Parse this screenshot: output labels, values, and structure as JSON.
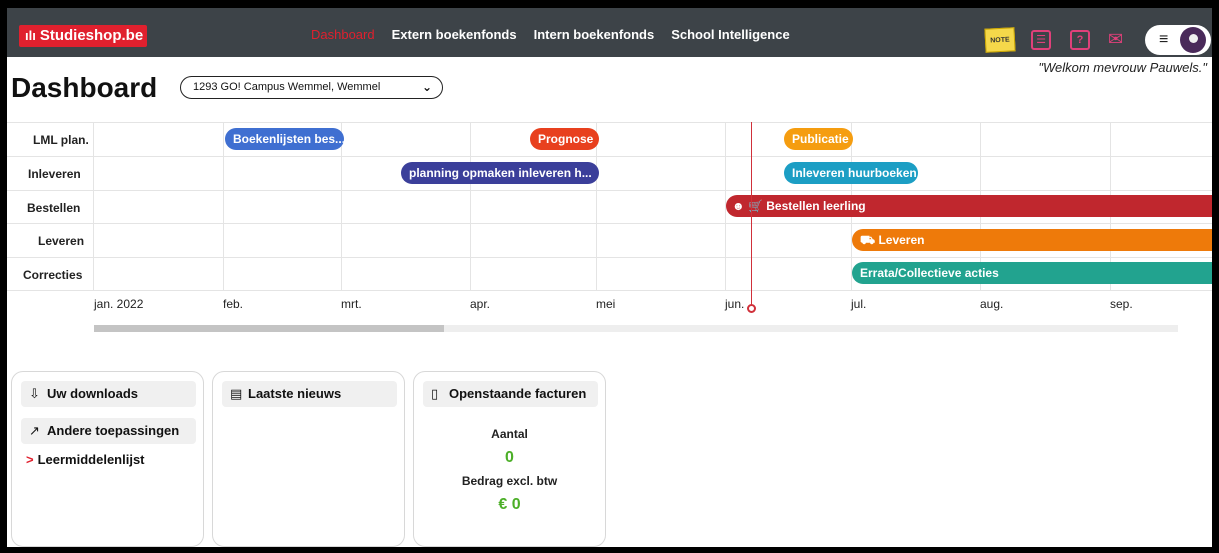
{
  "nav": {
    "brand": "Studieshop.be",
    "menu": [
      "Dashboard",
      "Extern boekenfonds",
      "Intern boekenfonds",
      "School Intelligence"
    ],
    "note_label": "NOTE",
    "help_label": "?",
    "accent_color": "#e0202e"
  },
  "header": {
    "title": "Dashboard",
    "school": "1293 GO! Campus Wemmel, Wemmel",
    "welcome": "\"Welkom mevrouw Pauwels.\""
  },
  "timeline": {
    "rows": [
      "LML plan.",
      "Inleveren",
      "Bestellen",
      "Leveren",
      "Correcties"
    ],
    "months": [
      "jan. 2022",
      "feb.",
      "mrt.",
      "apr.",
      "mei",
      "jun.",
      "jul.",
      "aug.",
      "sep."
    ],
    "bars": [
      {
        "label": "Boekenlijsten bes...",
        "color": "#3f6fd1"
      },
      {
        "label": "Prognose",
        "color": "#e8401e"
      },
      {
        "label": "Publicatie",
        "color": "#f59d10"
      },
      {
        "label": "planning opmaken inleveren h...",
        "color": "#3b3f9a"
      },
      {
        "label": "Inleveren huurboeken",
        "color": "#1c9ec4"
      },
      {
        "label": "Bestellen leerling",
        "color": "#c0272e"
      },
      {
        "label": "Leveren",
        "color": "#ee7a0a"
      },
      {
        "label": "Errata/Collectieve acties",
        "color": "#22a38f"
      }
    ]
  },
  "cards": {
    "downloads": "Uw downloads",
    "other_apps": "Andere toepassingen",
    "link": "Leermiddelenlijst",
    "news": "Laatste nieuws",
    "invoices": "Openstaande facturen",
    "count_label": "Aantal",
    "count_value": "0",
    "amount_label": "Bedrag excl. btw",
    "amount_value": "€ 0"
  }
}
